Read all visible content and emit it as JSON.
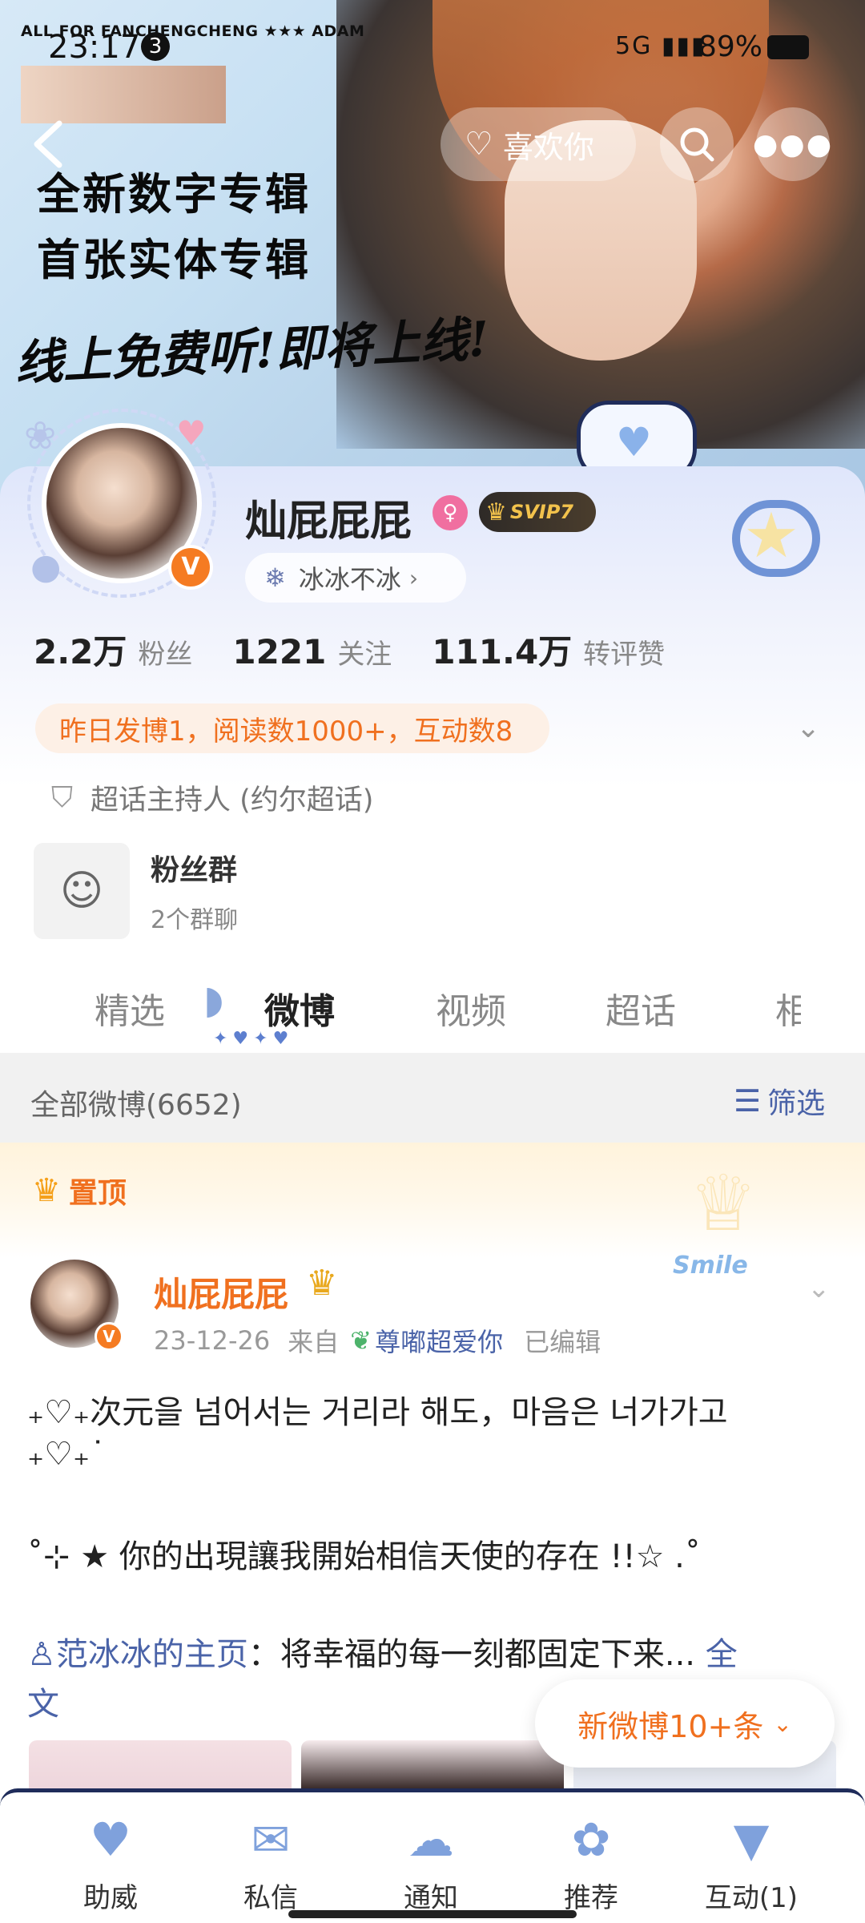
{
  "status_bar": {
    "caption": "ALL FOR FANCHENGCHENG ★★★ ADAM",
    "time": "23:17",
    "notification_count": "3",
    "network": "5G",
    "battery": "89%"
  },
  "banner": {
    "headline_1": "全新数字专辑",
    "headline_2": "首张实体专辑",
    "handwritten": "线上免费听!即将上线!"
  },
  "nav": {
    "like_label": "喜欢你"
  },
  "profile": {
    "username": "灿屁屁屁",
    "vip_badge": "SVIP7",
    "fan_group_pill": "冰冰不冰",
    "stats": [
      {
        "num": "2.2万",
        "label": "粉丝"
      },
      {
        "num": "1221",
        "label": "关注"
      },
      {
        "num": "111.4万",
        "label": "转评赞"
      }
    ],
    "activity": "昨日发博1，阅读数1000+，互动数8",
    "host": "超话主持人 (约尔超话)",
    "group": {
      "title": "粉丝群",
      "subtitle": "2个群聊"
    }
  },
  "tabs": [
    "精选",
    "微博",
    "视频",
    "超话",
    "相"
  ],
  "filter": {
    "count": "全部微博(6652)",
    "label": "筛选"
  },
  "post": {
    "pinned": "置顶",
    "deco_text": "Smile",
    "author": "灿屁屁屁",
    "date": "23-12-26",
    "from": "来自",
    "source": "尊嘟超爱你",
    "edited": "已编辑",
    "line_1": "₊♡₊次元을 넘어서는 거리라 해도，마음은 너가가고",
    "line_2": "₊♡₊˙",
    "line_3": "˚⊹ ★ 你的出現讓我開始相信天使的存在 !!☆ .˚",
    "mention": "范冰冰的主页",
    "line_4_rest": "：将幸福的每一刻都固定下来... ",
    "full_text": "全",
    "line_5": "文"
  },
  "new_posts": "新微博10+条",
  "bottom_nav": [
    {
      "icon": "heart-cloud-icon",
      "label": "助威"
    },
    {
      "icon": "envelope-icon",
      "label": "私信"
    },
    {
      "icon": "cloud-sun-icon",
      "label": "通知"
    },
    {
      "icon": "flower-icon",
      "label": "推荐"
    },
    {
      "icon": "ice-cream-icon",
      "label": "互动(1)"
    }
  ]
}
